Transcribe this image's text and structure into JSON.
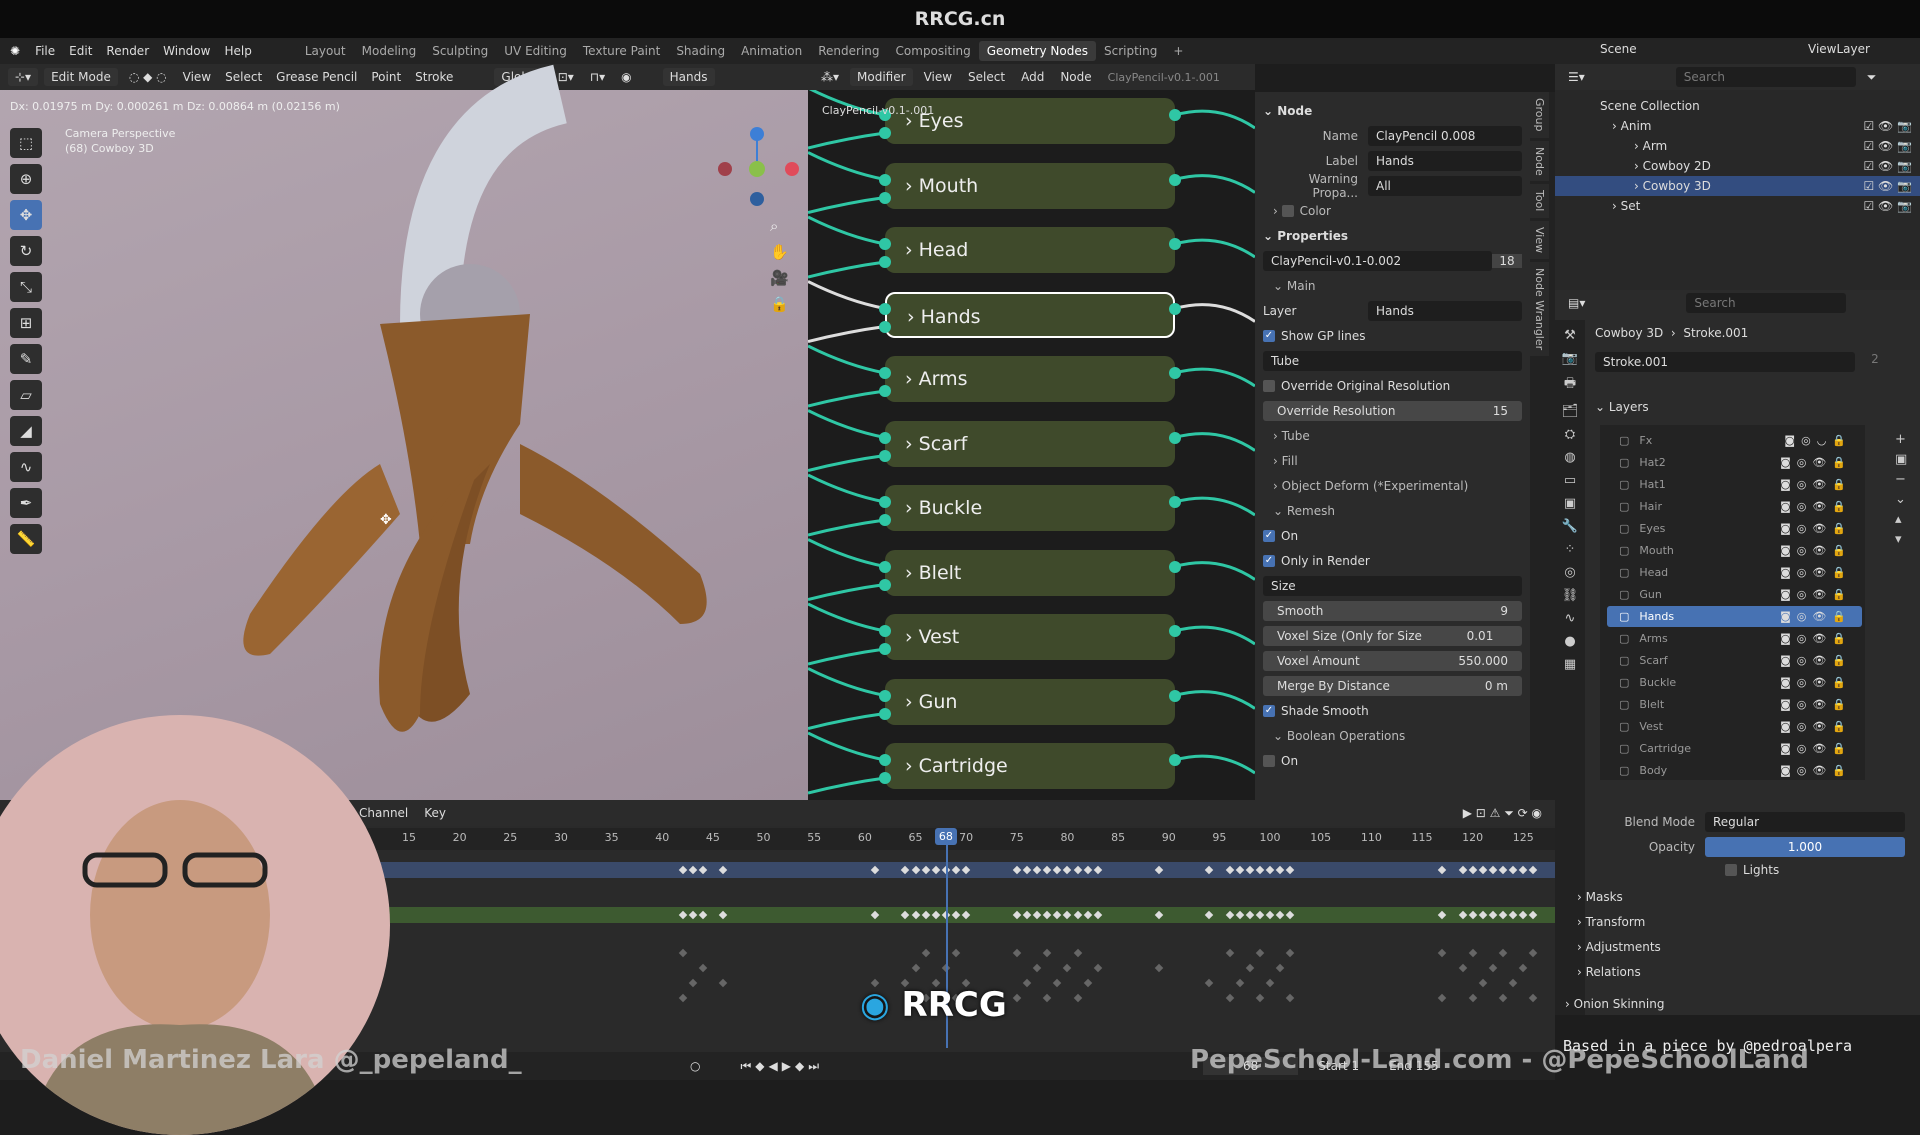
{
  "window": {
    "title": "RRCG.cn"
  },
  "menu": [
    "File",
    "Edit",
    "Render",
    "Window",
    "Help"
  ],
  "workspaces": [
    "Layout",
    "Modeling",
    "Sculpting",
    "UV Editing",
    "Texture Paint",
    "Shading",
    "Animation",
    "Rendering",
    "Compositing",
    "Geometry Nodes",
    "Scripting",
    "+"
  ],
  "active_workspace": "Geometry Nodes",
  "viewport": {
    "mode": "Edit Mode",
    "menus": [
      "View",
      "Select",
      "Grease Pencil",
      "Point",
      "Stroke"
    ],
    "orientation": "Global",
    "layer": "Hands",
    "info": "Dx: 0.01975 m  Dy: 0.000261 m  Dz: 0.00864 m (0.02156 m)",
    "camera": "Camera Perspective",
    "object": "(68) Cowboy 3D"
  },
  "node_editor": {
    "menus": [
      "Modifier",
      "View",
      "Select",
      "Add",
      "Node"
    ],
    "tree": "ClayPencil-v0.1-.001",
    "breadcrumb": "ClayPencil-v0.1-.001",
    "nodes": [
      "Eyes",
      "Mouth",
      "Head",
      "Hands",
      "Arms",
      "Scarf",
      "Buckle",
      "Blelt",
      "Vest",
      "Gun",
      "Cartridge"
    ],
    "selected": "Hands"
  },
  "npanel": {
    "node_header": "Node",
    "name_label": "Name",
    "name": "ClayPencil 0.008",
    "label_label": "Label",
    "label": "Hands",
    "warn_label": "Warning Propa...",
    "warn": "All",
    "color": "Color",
    "properties": "Properties",
    "group": "ClayPencil-v0.1-0.002",
    "users": "18",
    "main": "Main",
    "layer_label": "Layer",
    "layer": "Hands",
    "show_gp": "Show GP lines",
    "type": "Tube",
    "override_orig": "Override Original Resolution",
    "override_res": "Override  Resolution",
    "override_res_val": "15",
    "tube": "Tube",
    "fill": "Fill",
    "deform": "Object Deform (*Experimental)",
    "remesh": "Remesh",
    "on": "On",
    "only_render": "Only in Render",
    "size": "Size",
    "smooth": "Smooth",
    "smooth_val": "9",
    "voxel_size": "Voxel Size (Only for Size Option)",
    "voxel_size_val": "0.01 m",
    "voxel_amount": "Voxel Amount",
    "voxel_amount_val": "550.000",
    "merge": "Merge By Distance",
    "merge_val": "0 m",
    "shade_smooth": "Shade Smooth",
    "boolean": "Boolean Operations",
    "bool_on": "On"
  },
  "ntabs": [
    "Group",
    "Node",
    "Tool",
    "View",
    "Node Wrangler"
  ],
  "outliner": {
    "search": "Search",
    "root": "Scene Collection",
    "items": [
      {
        "name": "Anim",
        "depth": 1
      },
      {
        "name": "Arm",
        "depth": 2
      },
      {
        "name": "Cowboy 2D",
        "depth": 2
      },
      {
        "name": "Cowboy 3D",
        "depth": 2,
        "selected": true
      },
      {
        "name": "Set",
        "depth": 1
      }
    ],
    "scene": "Scene",
    "view_layer": "ViewLayer"
  },
  "properties": {
    "search": "Search",
    "breadcrumb": [
      "Cowboy 3D",
      "Stroke.001"
    ],
    "data": "Stroke.001",
    "data_users": "2",
    "layers_header": "Layers",
    "layers": [
      "Fx",
      "Hat2",
      "Hat1",
      "Hair",
      "Eyes",
      "Mouth",
      "Head",
      "Gun",
      "Hands",
      "Arms",
      "Scarf",
      "Buckle",
      "Blelt",
      "Vest",
      "Cartridge",
      "Body"
    ],
    "active_layer": "Hands",
    "blend_label": "Blend Mode",
    "blend": "Regular",
    "opacity_label": "Opacity",
    "opacity": "1.000",
    "lights": "Lights",
    "sections": [
      "Masks",
      "Transform",
      "Adjustments",
      "Relations"
    ],
    "onion": "Onion Skinning"
  },
  "timeline": {
    "menus": [
      "Channel",
      "Key"
    ],
    "ticks": [
      15,
      20,
      25,
      30,
      35,
      40,
      45,
      50,
      55,
      60,
      65,
      70,
      75,
      80,
      85,
      90,
      95,
      100,
      105,
      110,
      115,
      120,
      125
    ],
    "current_frame": 68,
    "keys": [
      42,
      43,
      44,
      46,
      61,
      64,
      65,
      66,
      67,
      68,
      69,
      70,
      75,
      76,
      77,
      78,
      79,
      80,
      81,
      82,
      83,
      89,
      94,
      96,
      97,
      98,
      99,
      100,
      101,
      102,
      117,
      119,
      120,
      121,
      122,
      123,
      124,
      125,
      126
    ],
    "frame_field": "68",
    "start_label": "Start",
    "start": "1",
    "end_label": "End",
    "end": "155"
  },
  "console": {
    "text": "Based in a piece by @pedroalpera"
  },
  "watermarks": {
    "author": "Daniel Martinez Lara @_pepeland_",
    "site": "PepeSchool-Land.com - @PepeSchoolLand",
    "logo": "RRCG 人人素材"
  },
  "colors": {
    "accent": "#4772b3",
    "socket": "#2fc7a5",
    "node": "#3f4a2b"
  }
}
